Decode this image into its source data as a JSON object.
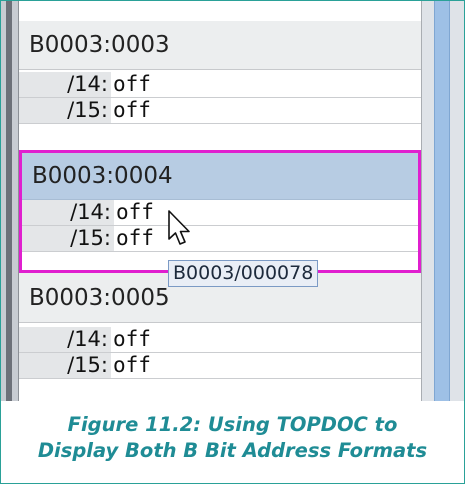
{
  "entries": [
    {
      "address": "B0003:0003",
      "bits": [
        {
          "label": "/14:",
          "value": "off"
        },
        {
          "label": "/15:",
          "value": "off"
        }
      ]
    },
    {
      "address": "B0003:0004",
      "bits": [
        {
          "label": "/14:",
          "value": "off"
        },
        {
          "label": "/15:",
          "value": "off"
        }
      ]
    },
    {
      "address": "B0003:0005",
      "bits": [
        {
          "label": "/14:",
          "value": "off"
        },
        {
          "label": "/15:",
          "value": "off"
        }
      ]
    }
  ],
  "tooltip": "B0003/000078",
  "caption": {
    "line1": "Figure 11.2: Using TOPDOC to",
    "line2": "Display Both B Bit Address Formats"
  },
  "colors": {
    "selection_border": "#e01fcf",
    "selected_header": "#b7cce3",
    "caption": "#1f8c95"
  }
}
